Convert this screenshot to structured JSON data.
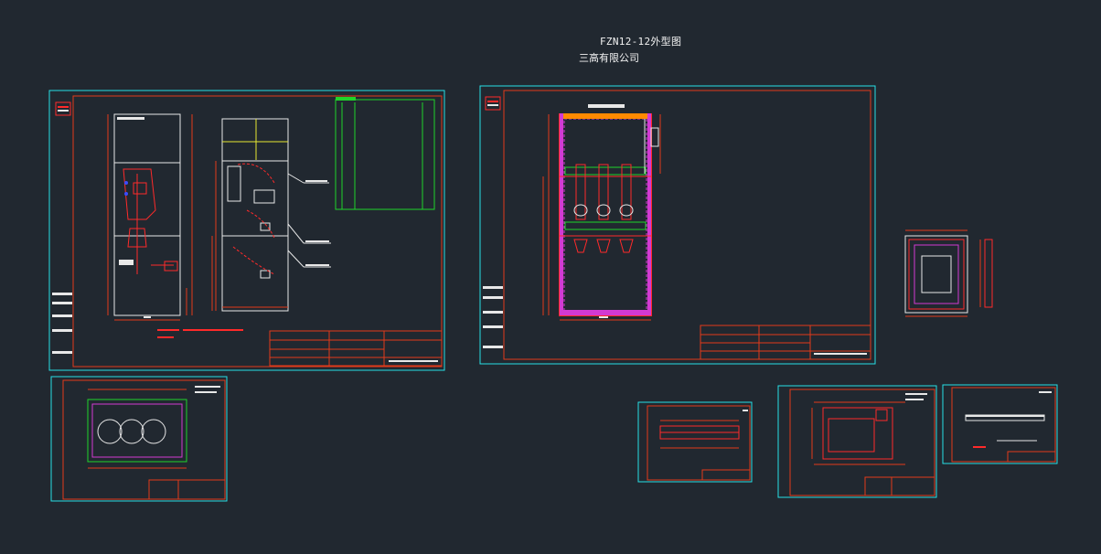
{
  "title": "FZN12-12外型图",
  "company": "三高有限公司",
  "colors": {
    "background": "#212830",
    "sheet_border": "#27e0e6",
    "frame": "#e23a1a",
    "drawing_red": "#ff2a2a",
    "drawing_white": "#e8e8e8",
    "drawing_green": "#1fd32a",
    "drawing_magenta": "#d23ad2",
    "drawing_yellow": "#e8e832",
    "drawing_blue": "#3a4cff",
    "drawing_orange": "#ff8a00"
  },
  "sheets": [
    {
      "id": "front-side-view",
      "icon": "cabinet-elevation-icon"
    },
    {
      "id": "internal-layout",
      "icon": "cabinet-section-icon"
    },
    {
      "id": "panel-detail",
      "icon": "panel-outline-icon"
    },
    {
      "id": "base-plate",
      "icon": "base-plate-icon"
    },
    {
      "id": "busbar-strip",
      "icon": "busbar-icon"
    },
    {
      "id": "mounting-plate",
      "icon": "mounting-plate-icon"
    },
    {
      "id": "cover-strip",
      "icon": "cover-strip-icon"
    }
  ]
}
